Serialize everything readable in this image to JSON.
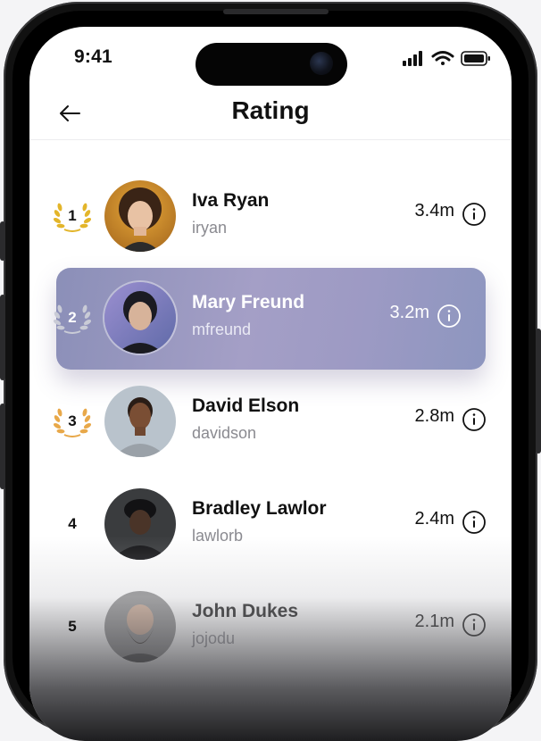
{
  "status_bar": {
    "time": "9:41"
  },
  "header": {
    "title": "Rating"
  },
  "ranking": [
    {
      "rank": "1",
      "name": "Iva Ryan",
      "handle": "iryan",
      "score": "3.4m",
      "medal": "gold"
    },
    {
      "rank": "2",
      "name": "Mary Freund",
      "handle": "mfreund",
      "score": "3.2m",
      "medal": "silver",
      "selected": true
    },
    {
      "rank": "3",
      "name": "David Elson",
      "handle": "davidson",
      "score": "2.8m",
      "medal": "bronze"
    },
    {
      "rank": "4",
      "name": "Bradley Lawlor",
      "handle": "lawlorb",
      "score": "2.4m"
    },
    {
      "rank": "5",
      "name": "John Dukes",
      "handle": "jojodu",
      "score": "2.1m"
    }
  ],
  "colors": {
    "gold": "#e3b52a",
    "silver": "#c9cbd6",
    "bronze": "#e8a849",
    "highlight": "#9c9bc3"
  },
  "icons": {
    "back": "arrow-left-icon",
    "info": "info-circle-icon",
    "laurel": "laurel-wreath-icon"
  }
}
